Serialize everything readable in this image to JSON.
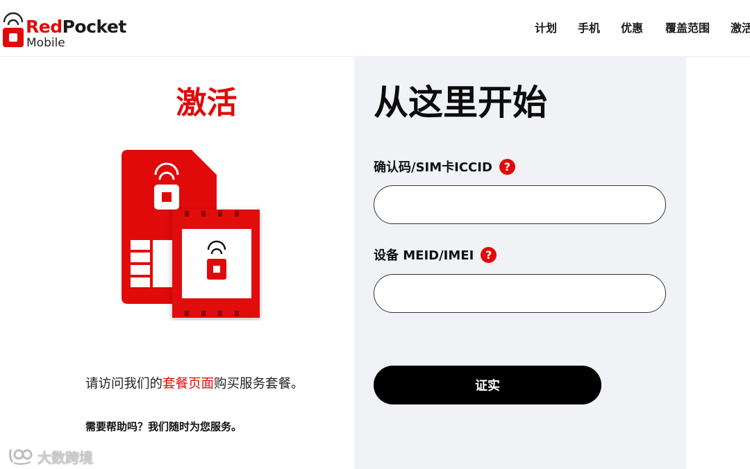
{
  "brand": {
    "name_red": "Red",
    "name_dark": "Pocket",
    "sub": "Mobile",
    "accent_color": "#e10a0a"
  },
  "nav": {
    "items": [
      {
        "label": "计划"
      },
      {
        "label": "手机"
      },
      {
        "label": "优惠"
      },
      {
        "label": "覆盖范围"
      },
      {
        "label": "激活"
      }
    ]
  },
  "left": {
    "title": "激活",
    "illustration_icon": "sim-card-icon",
    "visit_prefix": "请访问我们的",
    "visit_link": "套餐页面",
    "visit_suffix": "购买服务套餐。",
    "help_text": "需要帮助吗？我们随时为您服务。",
    "watermark": "大数跨境"
  },
  "form": {
    "title": "从这里开始",
    "fields": [
      {
        "label": "确认码/SIM卡ICCID",
        "help_icon": "question-icon",
        "value": "",
        "placeholder": ""
      },
      {
        "label": "设备 MEID/IMEI",
        "help_icon": "question-icon",
        "value": "",
        "placeholder": ""
      }
    ],
    "help_glyph": "?",
    "submit_label": "证实"
  }
}
